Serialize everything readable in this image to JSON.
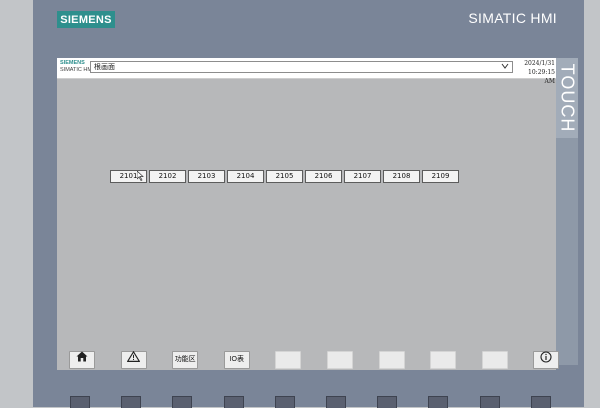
{
  "device": {
    "brand": "SIEMENS",
    "model": "SIMATIC HMI",
    "touch_label": "TOUCH",
    "bezel_color": "#7a8598",
    "brand_color": "#2e8f8d"
  },
  "topbar": {
    "mini_logo_brand": "SIEMENS",
    "mini_logo_model": "SIMATIC HMI",
    "screen_selector_value": "根画面",
    "date": "2024/1/31",
    "time": "10:29:15 AM"
  },
  "stations": [
    "2101",
    "2102",
    "2103",
    "2104",
    "2105",
    "2106",
    "2107",
    "2108",
    "2109"
  ],
  "function_keys": [
    {
      "icon": "home-icon",
      "label": ""
    },
    {
      "icon": "alarm-warning-icon",
      "label": ""
    },
    {
      "icon": "",
      "label": "功能区"
    },
    {
      "icon": "",
      "label": "IO表"
    },
    {
      "icon": "",
      "label": ""
    },
    {
      "icon": "",
      "label": ""
    },
    {
      "icon": "",
      "label": ""
    },
    {
      "icon": "",
      "label": ""
    },
    {
      "icon": "",
      "label": ""
    },
    {
      "icon": "info-icon",
      "label": ""
    }
  ]
}
